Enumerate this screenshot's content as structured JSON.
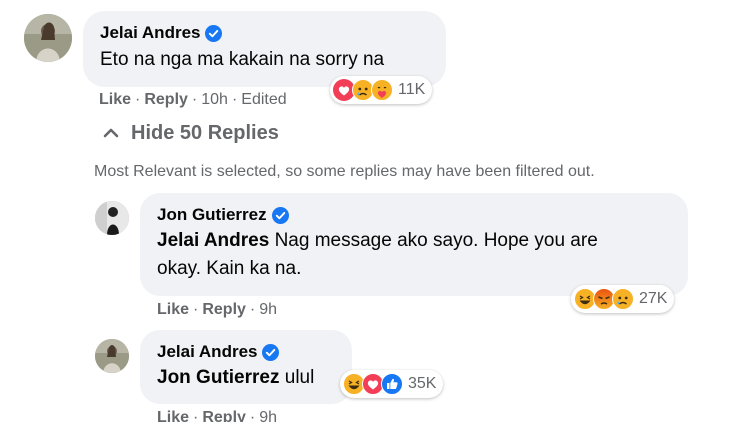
{
  "comments": [
    {
      "author": "Jelai Andres",
      "text": "Eto na nga ma kakain na sorry na",
      "actions": {
        "like": "Like",
        "reply": "Reply",
        "time": "10h",
        "edited": "Edited"
      },
      "reactions": {
        "icons": [
          "love",
          "sad",
          "care"
        ],
        "count": "11K"
      }
    },
    {
      "author": "Jon Gutierrez",
      "mention": "Jelai Andres",
      "text": "Nag message ako sayo. Hope you are",
      "text_line2": "okay. Kain ka na.",
      "actions": {
        "like": "Like",
        "reply": "Reply",
        "time": "9h"
      },
      "reactions": {
        "icons": [
          "haha",
          "angry",
          "sad"
        ],
        "count": "27K"
      }
    },
    {
      "author": "Jelai Andres",
      "mention": "Jon Gutierrez",
      "text": "ulul",
      "actions": {
        "like": "Like",
        "reply": "Reply",
        "time": "9h"
      },
      "reactions": {
        "icons": [
          "haha",
          "love",
          "like"
        ],
        "count": "35K"
      }
    }
  ],
  "replies_toggle": {
    "label": "Hide 50 Replies"
  },
  "filter_notice": "Most Relevant is selected, so some replies may have been filtered out.",
  "colors": {
    "bubble": "#f0f2f5",
    "secondary_text": "#65676b",
    "verified": "#1877f2",
    "love": "#f33e58",
    "haha": "#f7b125",
    "angry": "#e9710f",
    "like": "#1877f2"
  }
}
